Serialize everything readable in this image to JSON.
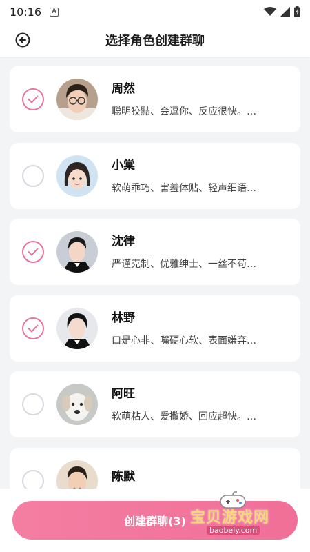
{
  "status_bar": {
    "time": "10:16",
    "notification_icon": "a-letter-icon"
  },
  "header": {
    "title": "选择角色创建群聊",
    "back_icon": "back-arrow-icon"
  },
  "characters": [
    {
      "name": "周然",
      "description": "聪明狡黠、会逗你、反应很快。…",
      "selected": true
    },
    {
      "name": "小棠",
      "description": "软萌乖巧、害羞体贴、轻声细语…",
      "selected": false
    },
    {
      "name": "沈律",
      "description": "严谨克制、优雅绅士、一丝不苟…",
      "selected": true
    },
    {
      "name": "林野",
      "description": "口是心非、嘴硬心软、表面嫌弃…",
      "selected": true
    },
    {
      "name": "阿旺",
      "description": "软萌粘人、爱撒娇、回应超快。…",
      "selected": false
    },
    {
      "name": "陈默",
      "description": "",
      "selected": false
    }
  ],
  "footer": {
    "create_button_label": "创建群聊(3)"
  },
  "watermark": {
    "brand": "宝贝游戏网",
    "url": "baobeiy.com"
  },
  "colors": {
    "accent": "#f0709a",
    "check": "#e8739b",
    "background": "#f3f4f6"
  }
}
